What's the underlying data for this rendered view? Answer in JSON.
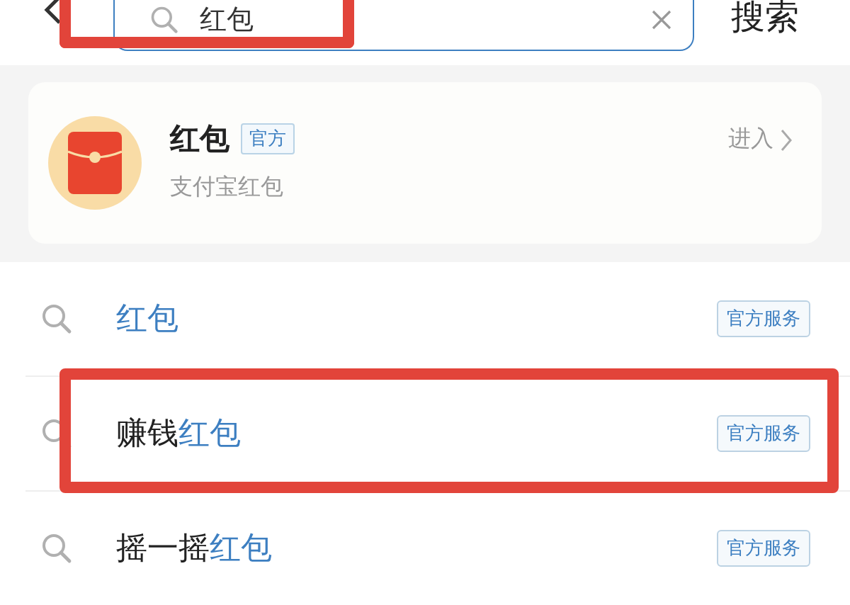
{
  "search": {
    "value": "红包",
    "highlighted": true,
    "submit": "搜索"
  },
  "result_card": {
    "title": "红包",
    "badge": "官方",
    "subtitle": "支付宝红包",
    "action": "进入"
  },
  "suggestions": [
    {
      "match": "红包",
      "tag": "官方服务",
      "highlighted": false
    },
    {
      "prefix": "赚钱",
      "match": "红包",
      "tag": "官方服务",
      "highlighted": true
    },
    {
      "prefix": "摇一摇",
      "match": "红包",
      "tag": "官方服务",
      "highlighted": false
    }
  ]
}
